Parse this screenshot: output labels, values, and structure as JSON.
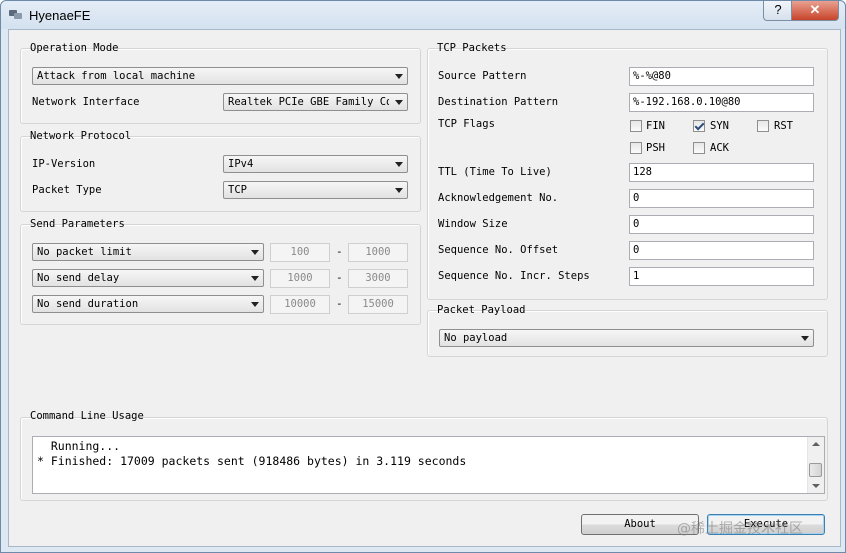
{
  "window": {
    "title": "HyenaeFE",
    "help_label": "?",
    "close_label": "✕"
  },
  "operation_mode": {
    "title": "Operation Mode",
    "mode_value": "Attack from local machine",
    "network_interface_label": "Network Interface",
    "network_interface_value": "Realtek PCIe GBE Family Con"
  },
  "network_protocol": {
    "title": "Network Protocol",
    "ip_version_label": "IP-Version",
    "ip_version_value": "IPv4",
    "packet_type_label": "Packet Type",
    "packet_type_value": "TCP"
  },
  "send_parameters": {
    "title": "Send Parameters",
    "rows": [
      {
        "option": "No packet limit",
        "min": "100",
        "max": "1000"
      },
      {
        "option": "No send delay",
        "min": "1000",
        "max": "3000"
      },
      {
        "option": "No send duration",
        "min": "10000",
        "max": "15000"
      }
    ],
    "separator": "-"
  },
  "tcp_packets": {
    "title": "TCP Packets",
    "source_pattern_label": "Source Pattern",
    "source_pattern_value": "%-%@80",
    "destination_pattern_label": "Destination Pattern",
    "destination_pattern_value": "%-192.168.0.10@80",
    "tcp_flags_label": "TCP Flags",
    "flags": [
      {
        "name": "FIN",
        "checked": false
      },
      {
        "name": "SYN",
        "checked": true
      },
      {
        "name": "RST",
        "checked": false
      },
      {
        "name": "PSH",
        "checked": false
      },
      {
        "name": "ACK",
        "checked": false
      }
    ],
    "ttl_label": "TTL (Time To Live)",
    "ttl_value": "128",
    "ack_label": "Acknowledgement No.",
    "ack_value": "0",
    "window_size_label": "Window Size",
    "window_size_value": "0",
    "seq_offset_label": "Sequence No. Offset",
    "seq_offset_value": "0",
    "seq_steps_label": "Sequence No. Incr. Steps",
    "seq_steps_value": "1"
  },
  "packet_payload": {
    "title": "Packet Payload",
    "value": "No payload"
  },
  "command_line": {
    "title": "Command Line Usage",
    "lines": [
      "  Running...",
      "* Finished: 17009 packets sent (918486 bytes) in 3.119 seconds"
    ]
  },
  "buttons": {
    "about_label": "About",
    "execute_label": "Execute"
  },
  "watermark": "@稀土掘金技术社区",
  "colors": {
    "titlebar": "#d8e4f1",
    "close_button": "#c8442a",
    "client_bg": "#f0f0f0"
  }
}
